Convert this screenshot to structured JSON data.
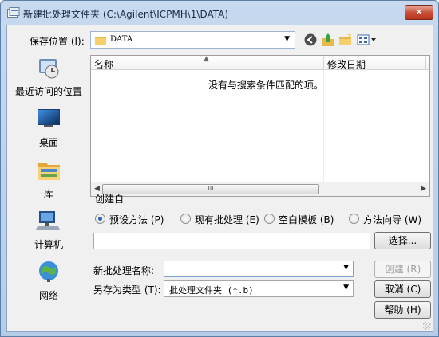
{
  "window": {
    "title": "新建批处理文件夹 (C:\\Agilent\\ICPMH\\1\\DATA)",
    "close_label": "✕"
  },
  "lookin": {
    "label": "保存位置 (I):",
    "value": "DATA",
    "toolbar_icons": [
      "back-icon",
      "up-folder-icon",
      "new-folder-icon",
      "view-menu-icon"
    ]
  },
  "places": [
    {
      "label": "最近访问的位置",
      "icon": "recent-places-icon"
    },
    {
      "label": "桌面",
      "icon": "desktop-icon"
    },
    {
      "label": "库",
      "icon": "libraries-icon"
    },
    {
      "label": "计算机",
      "icon": "computer-icon"
    },
    {
      "label": "网络",
      "icon": "network-icon"
    }
  ],
  "filelist": {
    "columns": [
      "名称",
      "修改日期"
    ],
    "empty_message": "没有与搜索条件匹配的项。",
    "scroll_thumb": "III"
  },
  "create_from": {
    "label": "创建自",
    "options": [
      {
        "label": "预设方法 (P)",
        "selected": true
      },
      {
        "label": "现有批处理 (E)",
        "selected": false
      },
      {
        "label": "空白模板 (B)",
        "selected": false
      },
      {
        "label": "方法向导 (W)",
        "selected": false
      }
    ],
    "path_value": "",
    "browse_label": "选择..."
  },
  "form": {
    "name_label": "新批处理名称:",
    "name_value": "",
    "type_label": "另存为类型 (T):",
    "type_value": "批处理文件夹 (*.b)"
  },
  "buttons": {
    "create": "创建 (R)",
    "cancel": "取消 (C)",
    "help": "帮助 (H)"
  }
}
